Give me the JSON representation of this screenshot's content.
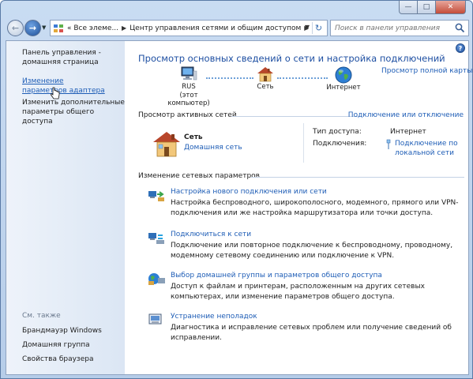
{
  "address": {
    "crumb1": "« Все элеме...",
    "crumb2": "Центр управления сетями и общим доступом"
  },
  "search": {
    "placeholder": "Поиск в панели управления"
  },
  "sidebar": {
    "home": "Панель управления - домашняя страница",
    "adapter": "Изменение параметров адаптера",
    "sharing": "Изменить дополнительные параметры общего доступа",
    "see_also": "См. также",
    "items": [
      "Брандмауэр Windows",
      "Домашняя группа",
      "Свойства браузера"
    ]
  },
  "main": {
    "title": "Просмотр основных сведений о сети и настройка подключений",
    "full_map": "Просмотр полной карты",
    "map": {
      "computer_name": "RUS",
      "computer_sub": "(этот компьютер)",
      "network": "Сеть",
      "internet": "Интернет"
    },
    "active_head": "Просмотр активных сетей",
    "connect_disconnect": "Подключение или отключение",
    "active": {
      "name": "Сеть",
      "type": "Домашняя сеть",
      "access_label": "Тип доступа:",
      "access_value": "Интернет",
      "conn_label": "Подключения:",
      "conn_value": "Подключение по локальной сети"
    },
    "change_head": "Изменение сетевых параметров",
    "tasks": [
      {
        "icon": "new-connection-icon",
        "link": "Настройка нового подключения или сети",
        "desc": "Настройка беспроводного, широкополосного, модемного, прямого или VPN-подключения или же настройка маршрутизатора или точки доступа."
      },
      {
        "icon": "connect-network-icon",
        "link": "Подключиться к сети",
        "desc": "Подключение или повторное подключение к беспроводному, проводному, модемному сетевому соединению или подключение к VPN."
      },
      {
        "icon": "homegroup-icon",
        "link": "Выбор домашней группы и параметров общего доступа",
        "desc": "Доступ к файлам и принтерам, расположенным на других сетевых компьютерах, или изменение параметров общего доступа."
      },
      {
        "icon": "troubleshoot-icon",
        "link": "Устранение неполадок",
        "desc": "Диагностика и исправление сетевых проблем или получение сведений об исправлении."
      }
    ]
  },
  "colors": {
    "link": "#1e5db6",
    "title": "#1e4fa2",
    "sidebar": "#dbe6f4"
  }
}
